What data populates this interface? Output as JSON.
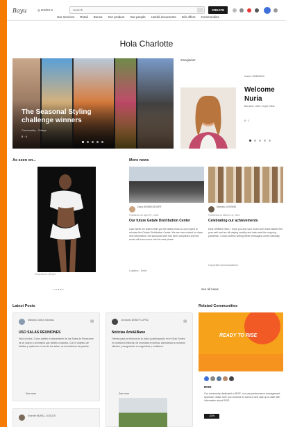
{
  "colors": {
    "accent": "#f57c00",
    "dark": "#1a1a1a",
    "avatar": "#3f6fd8"
  },
  "header": {
    "logo": "Bayu",
    "location": "ES/ES",
    "search_placeholder": "Search",
    "create_label": "CREATE",
    "nav": [
      "Our services",
      "Retail",
      "Bonus",
      "Our product",
      "Our people",
      "Useful documents",
      "Info offers",
      "Communities"
    ]
  },
  "greeting": "Hola Charlotte",
  "carousel": {
    "title": "The Seasonal Styling challenge winners",
    "meta": "Community - 3 days",
    "stats": "8 · 4"
  },
  "welcome": {
    "tag": "#newjoiner",
    "small": "Nuria LOMBARDA",
    "name_line1": "Welcome",
    "name_line2": "Nuria",
    "sub": "Bernardi, video, Doyle, Bear",
    "stats": "6 · 1"
  },
  "as_seen_on": {
    "title": "As seen on...",
    "caption": "#bayuvision @bayu",
    "pager": "< ● ● ● >"
  },
  "more_news": {
    "title": "More news",
    "see_all": "see all news",
    "items": [
      {
        "author": "Dany BOMBS BOURT",
        "date": "Published on April 07, 2021",
        "title": "Our future Getafe Distribution Center",
        "body": "Last month we shared with you the latest news on our project to relocate the Getafe Distribution Center. We are now excited to share new information: the structural work has been completed and the works will soon move into the next phase.",
        "footer": "Logistics · Editor"
      },
      {
        "author": "Marcelo JOSSINE",
        "date": "Published on March 16, 2021",
        "title": "Celebrating our achievements",
        "body": "Dear URBAN Team, I hope you and your loved ones have started the year well and are all staying healthy and safe amid the ongoing pandemic. I must confess writing these messages comes naturally.",
        "footer": "Corporate Communications"
      }
    ]
  },
  "latest_posts": {
    "title": "Latest Posts",
    "posts": [
      {
        "author": "Mariano Lisbon Cardoso",
        "title": "USO SALAS REUNIONES",
        "body": "Hola a todos. Como sabéis el aforamiento de las Salas de Reuniones se ve sujeto a normativa que debéis consultar. Con el objetivo de facilitar y optimizar el uso de las salas, os recordamos las pautas.",
        "more": "See more"
      },
      {
        "author": "Leonardo DEBUT LOPEZ",
        "title": "Noticias Artel&Bano",
        "body": "Ofertas para la reforma de tu baño y participación en el Gran Sorteo en nuestra Exhibición de muestras en tienda. Atendiendo a nuestros clientes y asegurando su seguridad y confianza.",
        "more": "See more"
      }
    ],
    "third_author": "Vicente MURILL JOGLES"
  },
  "related": {
    "title": "Related Communities",
    "banner_text": "READY TO RISE",
    "name": "RISE",
    "desc": "Our community dedicated to RISE, our new performance management approach. Make sure you continue to check in and stay up to date with information about RISE.",
    "join": "JOIN"
  }
}
